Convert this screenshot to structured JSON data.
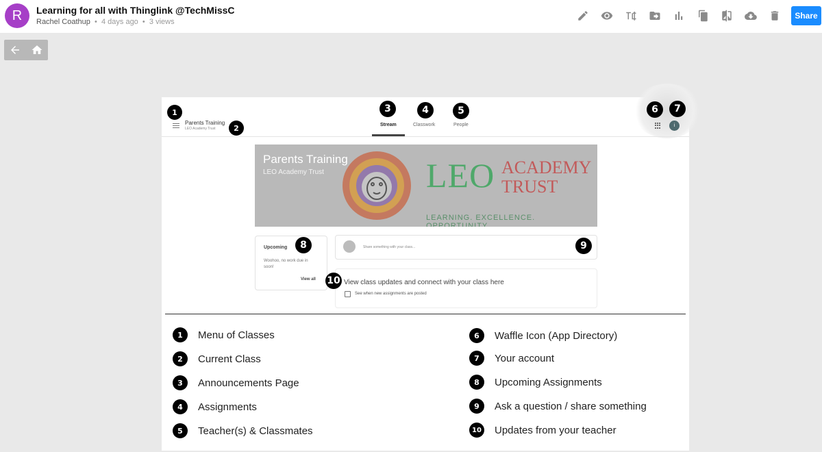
{
  "header": {
    "avatar_letter": "R",
    "title": "Learning for all with Thinglink @TechMissC",
    "author": "Rachel Coathup",
    "time_ago": "4 days ago",
    "views": "3 views",
    "share_label": "Share",
    "tools": [
      "pencil-icon",
      "eye-icon",
      "text-edit-icon",
      "folder-move-icon",
      "bar-chart-icon",
      "copy-icon",
      "compare-icon",
      "cloud-download-icon",
      "trash-icon"
    ]
  },
  "nav": {
    "back_icon": "arrow-left-icon",
    "home_icon": "home-icon"
  },
  "classroom": {
    "class_name": "Parents Training",
    "class_sub": "LEO Academy Trust",
    "tabs": [
      "Stream",
      "Classwork",
      "People"
    ],
    "active_tab": "Stream",
    "account_initial": "i",
    "banner": {
      "title": "Parents Training",
      "subtitle": "LEO Academy Trust",
      "logo_big": "LEO",
      "logo_academy": "ACADEMY",
      "logo_trust": "TRUST",
      "logo_tagline": "LEARNING. EXCELLENCE. OPPORTUNITY"
    },
    "upcoming": {
      "title": "Upcoming",
      "text": "Woohoo, no work due in soon!",
      "view_all": "View all"
    },
    "share_placeholder": "Share something with your class...",
    "updates": {
      "title": "View class updates and connect with your class here",
      "sub": "See when new assignments are posted"
    }
  },
  "markers": [
    "1",
    "2",
    "3",
    "4",
    "5",
    "6",
    "7",
    "8",
    "9",
    "10"
  ],
  "legend_left": [
    {
      "num": "1",
      "text": "Menu of Classes"
    },
    {
      "num": "2",
      "text": "Current Class"
    },
    {
      "num": "3",
      "text": "Announcements Page"
    },
    {
      "num": "4",
      "text": "Assignments"
    },
    {
      "num": "5",
      "text": "Teacher(s) & Classmates"
    }
  ],
  "legend_right": [
    {
      "num": "6",
      "text": "Waffle Icon (App Directory)"
    },
    {
      "num": "7",
      "text": "Your account"
    },
    {
      "num": "8",
      "text": "Upcoming Assignments"
    },
    {
      "num": "9",
      "text": "Ask a question / share something"
    },
    {
      "num": "10",
      "text": "Updates from your teacher"
    }
  ],
  "colors": {
    "accent": "#1a8cff",
    "avatar": "#a63fc7",
    "badge": "#000000"
  }
}
